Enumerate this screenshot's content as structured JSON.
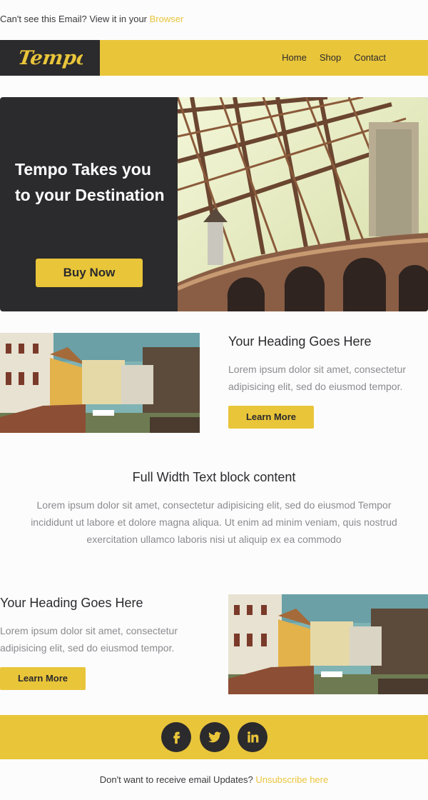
{
  "preheader": {
    "text": "Can't see this Email? View it in your ",
    "link": "Browser"
  },
  "logo": {
    "text": "Tempo"
  },
  "nav": {
    "items": [
      "Home",
      "Shop",
      "Contact"
    ]
  },
  "hero": {
    "title": "Tempo Takes you to your Destination",
    "button": "Buy Now"
  },
  "section1": {
    "heading": "Your Heading Goes Here",
    "body": "Lorem ipsum dolor sit amet, consectetur adipisicing elit, sed do eiusmod tempor.",
    "button": "Learn More"
  },
  "fullwidth": {
    "heading": "Full Width Text block content",
    "body": "Lorem ipsum dolor sit amet, consectetur adipisicing elit, sed do eiusmod Tempor incididunt ut labore et dolore magna aliqua. Ut enim ad minim veniam, quis nostrud exercitation ullamco laboris nisi ut aliquip ex ea commodo"
  },
  "section2": {
    "heading": "Your Heading Goes Here",
    "body": "Lorem ipsum dolor sit amet, consectetur adipisicing elit, sed do eiusmod tempor.",
    "button": "Learn More"
  },
  "social": {
    "icons": [
      "facebook-icon",
      "twitter-icon",
      "linkedin-icon"
    ]
  },
  "footer": {
    "text": "Don't want to receive email Updates? ",
    "link": "Unsubscribe here"
  },
  "colors": {
    "accent": "#e9c53a",
    "dark": "#2b2a2c",
    "muted": "#8b8a8d",
    "background": "#fdfcfd"
  }
}
